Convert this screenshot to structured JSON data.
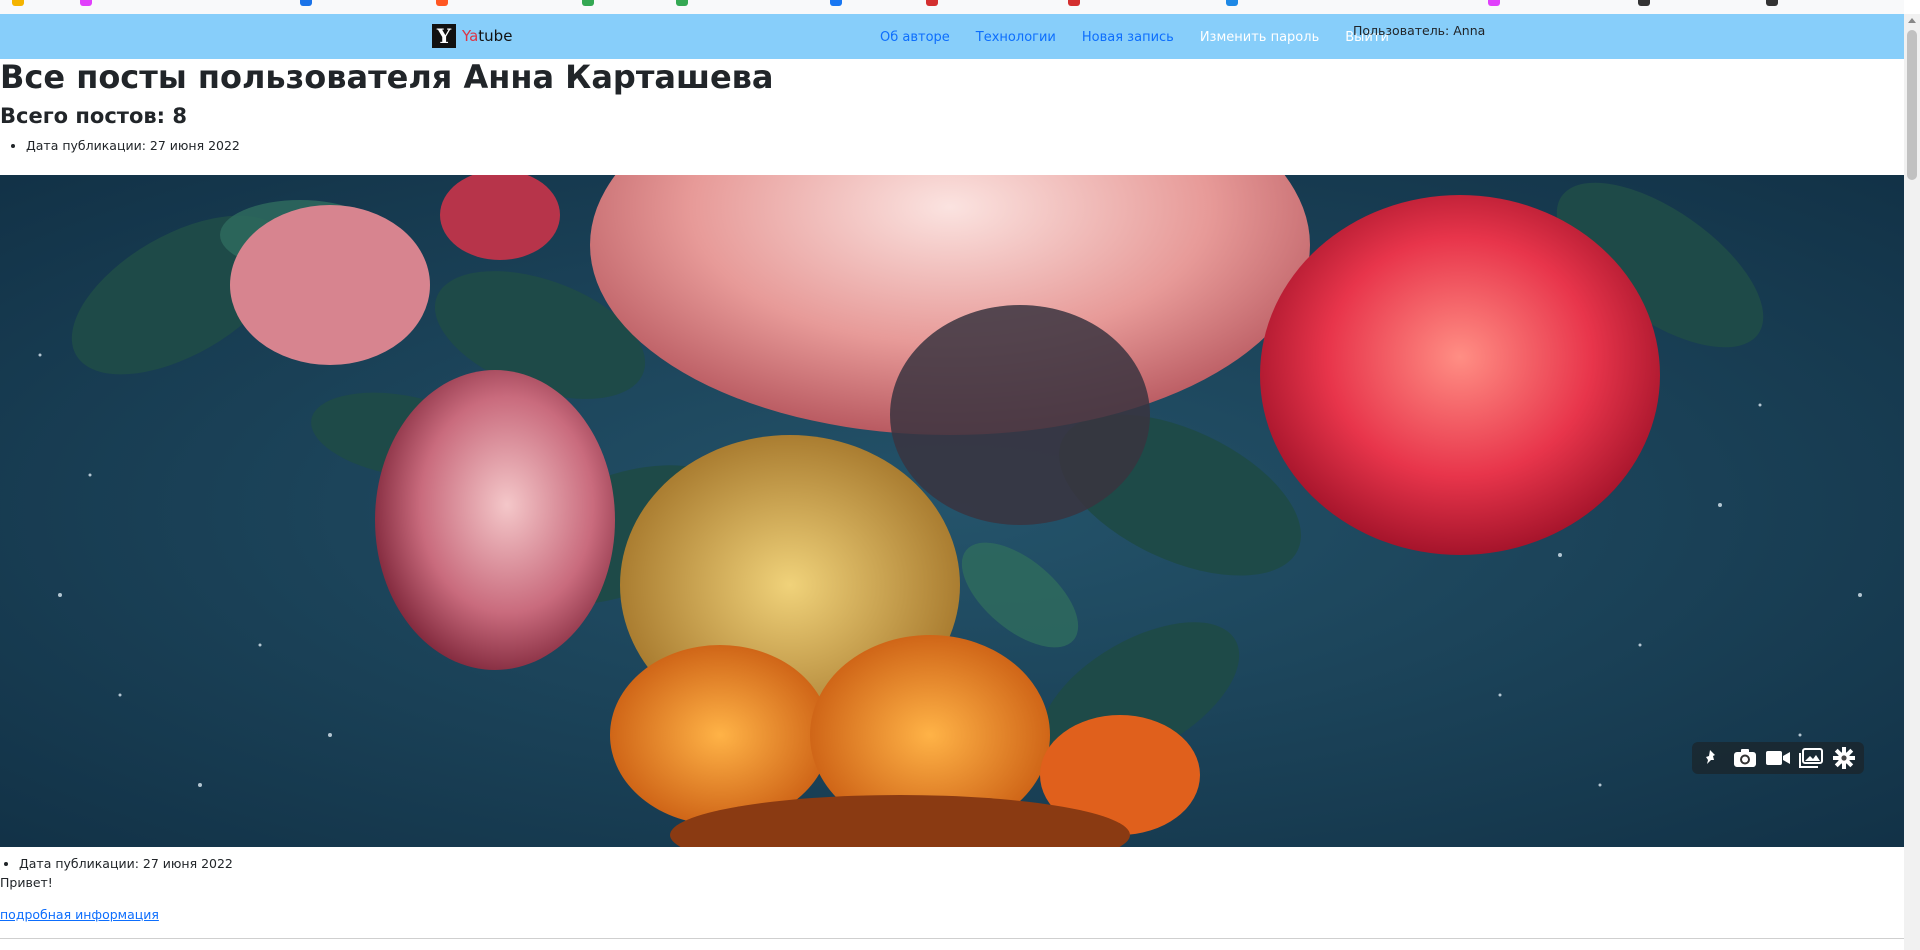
{
  "nav": {
    "brand_prefix": "Ya",
    "brand_suffix": "tube",
    "brand_logo_letter": "Y",
    "links": [
      "Об авторе",
      "Технологии",
      "Новая запись",
      "Изменить пароль",
      "Выйти"
    ],
    "user_label": "Пользователь: Anna"
  },
  "profile": {
    "title": "Все посты пользователя Анна Карташева",
    "post_count": "Всего постов: 8"
  },
  "posts": [
    {
      "date_line": "Дата публикации: 27 июня 2022"
    },
    {
      "date_line": "Дата публикации: 27 июня 2022",
      "text": "Привет!",
      "details_link": "подробная информация"
    }
  ],
  "image_toolbar": {
    "icons": [
      "pin-icon",
      "camera-icon",
      "video-icon",
      "gallery-icon",
      "gear-icon"
    ]
  },
  "colors": {
    "navbar": "#87cefa",
    "link": "#0d6efd",
    "brand_accent": "#dc3545"
  }
}
